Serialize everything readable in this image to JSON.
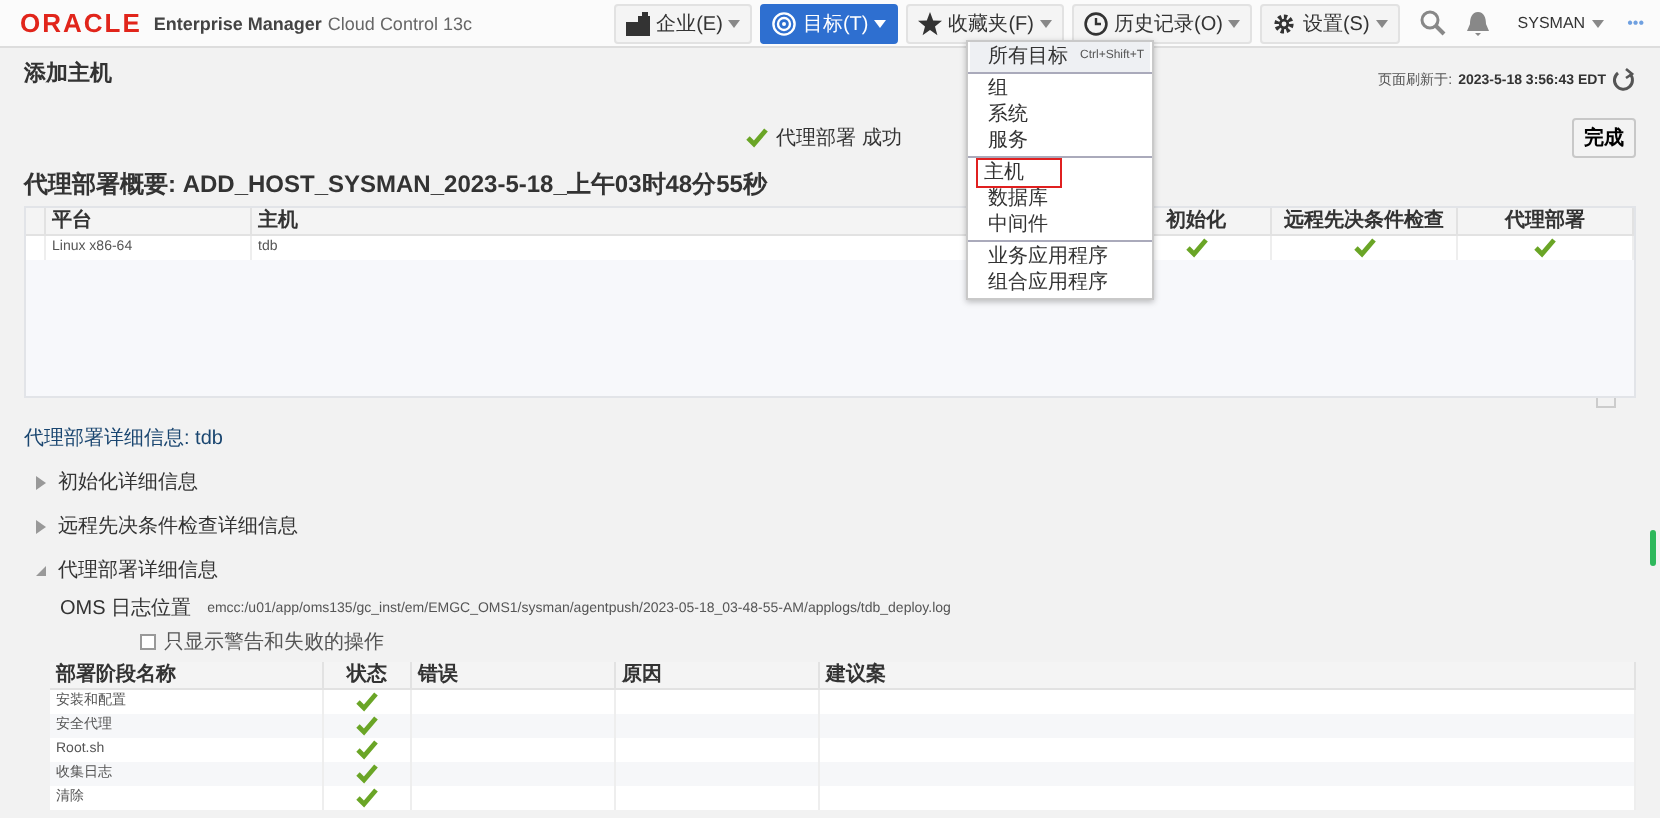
{
  "header": {
    "brand": "ORACLE",
    "product": "Enterprise Manager",
    "edition": "Cloud Control 13c",
    "menus": [
      {
        "label": "企业(E)",
        "selected": false
      },
      {
        "label": "目标(T)",
        "selected": true
      },
      {
        "label": "收藏夹(F)",
        "selected": false
      },
      {
        "label": "历史记录(O)",
        "selected": false
      },
      {
        "label": "设置(S)",
        "selected": false
      }
    ],
    "user": "SYSMAN",
    "more": "•••"
  },
  "dropdown": {
    "sections": [
      [
        {
          "label": "所有目标",
          "shortcut": "Ctrl+Shift+T",
          "highlighted": true,
          "outlined": false
        }
      ],
      [
        {
          "label": "组",
          "highlighted": false,
          "outlined": false
        },
        {
          "label": "系统",
          "highlighted": false,
          "outlined": false
        },
        {
          "label": "服务",
          "highlighted": false,
          "outlined": false
        }
      ],
      [
        {
          "label": "主机",
          "highlighted": false,
          "outlined": true
        },
        {
          "label": "数据库",
          "highlighted": false,
          "outlined": false
        },
        {
          "label": "中间件",
          "highlighted": false,
          "outlined": false
        }
      ],
      [
        {
          "label": "业务应用程序",
          "highlighted": false,
          "outlined": false
        },
        {
          "label": "组合应用程序",
          "highlighted": false,
          "outlined": false
        }
      ]
    ]
  },
  "page": {
    "title": "添加主机",
    "refreshed_label": "页面刷新于:",
    "refreshed_time": "2023-5-18 3:56:43 EDT",
    "done_button": "完成",
    "status": {
      "text": "代理部署 成功",
      "success": true
    }
  },
  "summary": {
    "title": "代理部署概要: ADD_HOST_SYSMAN_2023-5-18_上午03时48分55秒",
    "columns": [
      "平台",
      "主机",
      "初始化",
      "远程先决条件检查",
      "代理部署"
    ],
    "rows": [
      {
        "platform": "Linux x86-64",
        "host": "tdb",
        "init_done": true,
        "prereq_done": true,
        "deploy_done": true
      }
    ]
  },
  "details": {
    "title": "代理部署详细信息: tdb",
    "sections": [
      {
        "label": "初始化详细信息",
        "expanded": false
      },
      {
        "label": "远程先决条件检查详细信息",
        "expanded": false
      },
      {
        "label": "代理部署详细信息",
        "expanded": true
      }
    ],
    "log_label": "OMS 日志位置",
    "log_path": "emcc:/u01/app/oms135/gc_inst/em/EMGC_OMS1/sysman/agentpush/2023-05-18_03-48-55-AM/applogs/tdb_deploy.log",
    "filter": {
      "label": "只显示警告和失败的操作",
      "checked": false
    },
    "columns": [
      "部署阶段名称",
      "状态",
      "错误",
      "原因",
      "建议案"
    ],
    "rows": [
      {
        "name": "安装和配置",
        "done": true
      },
      {
        "name": "安全代理",
        "done": true
      },
      {
        "name": "Root.sh",
        "done": true
      },
      {
        "name": "收集日志",
        "done": true
      },
      {
        "name": "清除",
        "done": true
      }
    ]
  }
}
